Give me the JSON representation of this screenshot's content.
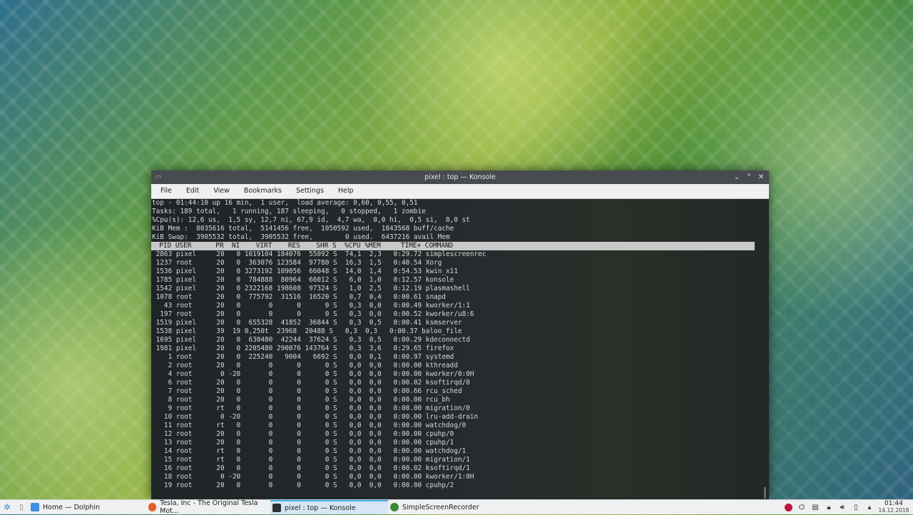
{
  "window": {
    "title": "pixel : top — Konsole",
    "sys_icon": "konsole-icon",
    "buttons": {
      "minimize": "⌄",
      "maximize": "⌃",
      "close": "✕"
    }
  },
  "menu": [
    "File",
    "Edit",
    "View",
    "Bookmarks",
    "Settings",
    "Help"
  ],
  "top": {
    "summary": [
      "top - 01:44:10 up 16 min,  1 user,  load average: 0,60, 0,55, 0,51",
      "Tasks: 189 total,   1 running, 187 sleeping,   0 stopped,   1 zombie",
      "%Cpu(s): 12,6 us,  1,5 sy, 12,7 ni, 67,9 id,  4,7 wa,  0,0 hi,  0,5 si,  0,0 st",
      "KiB Mem :  8035616 total,  5141456 free,  1050592 used,  1843568 buff/cache",
      "KiB Swap:  3905532 total,  3905532 free,        0 used.  6437216 avail Mem"
    ],
    "header": "  PID USER      PR  NI    VIRT    RES    SHR S  %CPU %MEM     TIME+ COMMAND",
    "processes": [
      " 2863 pixel     20   0 1019104 184076  55092 S  74,1  2,3   0:29.72 simplescreenrec",
      " 1237 root      20   0  363076 123584  97780 S  16,3  1,5   0:40.54 Xorg",
      " 1536 pixel     20   0 3273192 109056  66048 S  14,0  1,4   0:54.53 kwin_x11",
      " 1785 pixel     20   0  784888  80964  66012 S   6,0  1,0   0:12.57 konsole",
      " 1542 pixel     20   0 2322168 198608  97324 S   1,0  2,5   0:12.19 plasmashell",
      " 1078 root      20   0  775792  31516  16520 S   0,7  0,4   0:00.61 snapd",
      "   43 root      20   0       0      0      0 S   0,3  0,0   0:00.49 kworker/1:1",
      "  197 root      20   0       0      0      0 S   0,3  0,0   0:00.52 kworker/u8:6",
      " 1519 pixel     20   0  655328  41852  36844 S   0,3  0,5   0:00.41 ksmserver",
      " 1538 pixel     39  19 0,250t  23968  20488 S   0,3  0,3   0:00.37 baloo_file",
      " 1695 pixel     20   0  630480  42244  37624 S   0,3  0,5   0:00.29 kdeconnectd",
      " 1981 pixel     20   0 2205480 290076 143764 S   0,3  3,6   0:29.65 firefox",
      "    1 root      20   0  225240   9004   6692 S   0,0  0,1   0:00.97 systemd",
      "    2 root      20   0       0      0      0 S   0,0  0,0   0:00.00 kthreadd",
      "    4 root       0 -20       0      0      0 S   0,0  0,0   0:00.00 kworker/0:0H",
      "    6 root      20   0       0      0      0 S   0,0  0,0   0:00.02 ksoftirqd/0",
      "    7 root      20   0       0      0      0 S   0,0  0,0   0:00.66 rcu_sched",
      "    8 root      20   0       0      0      0 S   0,0  0,0   0:00.00 rcu_bh",
      "    9 root      rt   0       0      0      0 S   0,0  0,0   0:00.00 migration/0",
      "   10 root       0 -20       0      0      0 S   0,0  0,0   0:00.00 lru-add-drain",
      "   11 root      rt   0       0      0      0 S   0,0  0,0   0:00.00 watchdog/0",
      "   12 root      20   0       0      0      0 S   0,0  0,0   0:00.00 cpuhp/0",
      "   13 root      20   0       0      0      0 S   0,0  0,0   0:00.00 cpuhp/1",
      "   14 root      rt   0       0      0      0 S   0,0  0,0   0:00.00 watchdog/1",
      "   15 root      rt   0       0      0      0 S   0,0  0,0   0:00.00 migration/1",
      "   16 root      20   0       0      0      0 S   0,0  0,0   0:00.02 ksoftirqd/1",
      "   18 root       0 -20       0      0      0 S   0,0  0,0   0:00.00 kworker/1:0H",
      "   19 root      20   0       0      0      0 S   0,0  0,0   0:00.00 cpuhp/2"
    ]
  },
  "taskbar": {
    "launcher_icon": "app-launcher-icon",
    "pager_icon": "desktop-pager-icon",
    "tasks": [
      {
        "label": "Home — Dolphin",
        "icon": "dolphin-icon",
        "color": "#3d8ee0",
        "active": false
      },
      {
        "label": "Tesla, Inc - The Original Tesla Mot...",
        "icon": "firefox-icon",
        "color": "#e0612b",
        "active": false
      },
      {
        "label": "pixel : top — Konsole",
        "icon": "konsole-icon",
        "color": "#2b2f33",
        "active": true
      },
      {
        "label": "SimpleScreenRecorder",
        "icon": "simplescreenrecorder-icon",
        "color": "#3a8a3a",
        "active": false
      }
    ],
    "tray_icons": [
      "record-icon",
      "network-icon",
      "clipboard-icon",
      "lock-icon",
      "volume-icon",
      "kdeconnect-icon",
      "tray-expand-icon"
    ],
    "clock": {
      "time": "01:44",
      "date": "14.12.2018"
    }
  },
  "colors": {
    "accent": "#3daee9",
    "terminal_bg": "#202428",
    "header_bg": "#c9c9c9"
  }
}
